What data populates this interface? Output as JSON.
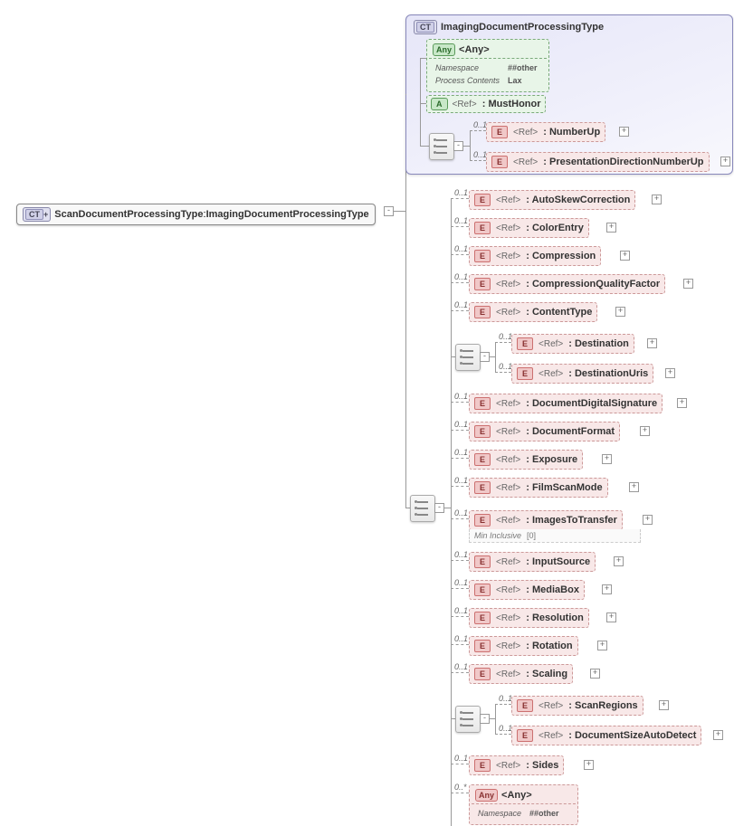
{
  "root": {
    "badge": "CT",
    "name": "ScanDocumentProcessingType",
    "sep": " : ",
    "base": "ImagingDocumentProcessingType"
  },
  "complexType": {
    "badge": "CT",
    "title": "ImagingDocumentProcessingType",
    "anyBlock": {
      "badge": "Any",
      "label": "<Any>",
      "namespaceLbl": "Namespace",
      "namespaceVal": "##other",
      "procLbl": "Process Contents",
      "procVal": "Lax"
    },
    "mustHonor": {
      "badge": "A",
      "ref": "<Ref>",
      "name": ": MustHonor"
    },
    "seq": [
      {
        "occ": "0..1",
        "badge": "E",
        "ref": "<Ref>",
        "name": ": NumberUp"
      },
      {
        "occ": "0..1",
        "badge": "E",
        "ref": "<Ref>",
        "name": ": PresentationDirectionNumberUp"
      }
    ]
  },
  "mainList": [
    {
      "occ": "0..1",
      "name": ": AutoSkewCorrection"
    },
    {
      "occ": "0..1",
      "name": ": ColorEntry"
    },
    {
      "occ": "0..1",
      "name": ": Compression"
    },
    {
      "occ": "0..1",
      "name": ": CompressionQualityFactor"
    },
    {
      "occ": "0..1",
      "name": ": ContentType"
    }
  ],
  "destGroup": [
    {
      "occ": "0..1",
      "name": ": Destination"
    },
    {
      "occ": "0..1",
      "name": ": DestinationUris"
    }
  ],
  "mainList2": [
    {
      "occ": "0..1",
      "name": ": DocumentDigitalSignature"
    },
    {
      "occ": "0..1",
      "name": ": DocumentFormat"
    },
    {
      "occ": "0..1",
      "name": ": Exposure"
    },
    {
      "occ": "0..1",
      "name": ": FilmScanMode"
    }
  ],
  "imagesToTransfer": {
    "occ": "0..1",
    "name": ": ImagesToTransfer",
    "constraintLabel": "Min Inclusive",
    "constraintVal": "[0]"
  },
  "mainList3": [
    {
      "occ": "0..1",
      "name": ": InputSource"
    },
    {
      "occ": "0..1",
      "name": ": MediaBox"
    },
    {
      "occ": "0..1",
      "name": ": Resolution"
    },
    {
      "occ": "0..1",
      "name": ": Rotation"
    },
    {
      "occ": "0..1",
      "name": ": Scaling"
    }
  ],
  "scanGroup": [
    {
      "occ": "0..1",
      "name": ": ScanRegions"
    },
    {
      "occ": "0..1",
      "name": ": DocumentSizeAutoDetect"
    }
  ],
  "sides": {
    "occ": "0..1",
    "name": ": Sides"
  },
  "bottomAny": {
    "occ": "0..*",
    "badge": "Any",
    "label": "<Any>",
    "nsLbl": "Namespace",
    "nsVal": "##other"
  },
  "common": {
    "eBadge": "E",
    "refLabel": "<Ref>",
    "plus": "+"
  }
}
